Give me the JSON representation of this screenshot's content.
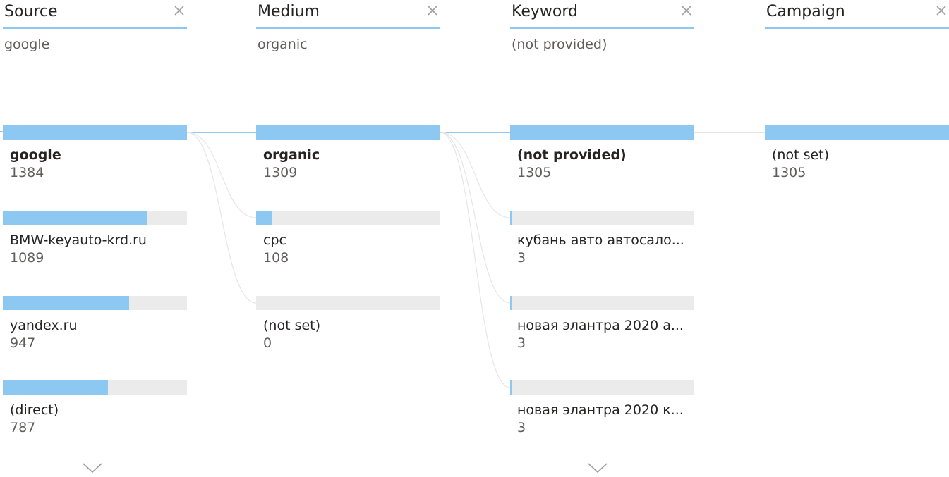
{
  "colors": {
    "accent": "#8dc8f3",
    "track": "#ebebeb",
    "text": "#252423",
    "muted": "#605e5c",
    "line": "#e0e0e0"
  },
  "columns": [
    {
      "title": "Source",
      "selected_value": "google",
      "nodes": [
        {
          "label": "google",
          "value": "1384",
          "fill_fraction": 1.0,
          "selected": true
        },
        {
          "label": "BMW-keyauto-krd.ru",
          "value": "1089",
          "fill_fraction": 0.787
        },
        {
          "label": "yandex.ru",
          "value": "947",
          "fill_fraction": 0.684
        },
        {
          "label": "(direct)",
          "value": "787",
          "fill_fraction": 0.569
        }
      ],
      "has_more": true
    },
    {
      "title": "Medium",
      "selected_value": "organic",
      "nodes": [
        {
          "label": "organic",
          "value": "1309",
          "fill_fraction": 1.0,
          "selected": true
        },
        {
          "label": "cpc",
          "value": "108",
          "fill_fraction": 0.083
        },
        {
          "label": "(not set)",
          "value": "0",
          "fill_fraction": 0.0
        }
      ],
      "has_more": false
    },
    {
      "title": "Keyword",
      "selected_value": "(not provided)",
      "nodes": [
        {
          "label": "(not provided)",
          "value": "1305",
          "fill_fraction": 1.0,
          "selected": true
        },
        {
          "label": "кубань авто автосало...",
          "value": "3",
          "fill_fraction": 0.002
        },
        {
          "label": "новая элантра 2020 а...",
          "value": "3",
          "fill_fraction": 0.002
        },
        {
          "label": "новая элантра 2020 к...",
          "value": "3",
          "fill_fraction": 0.002
        }
      ],
      "has_more": true
    },
    {
      "title": "Campaign",
      "selected_value": "",
      "nodes": [
        {
          "label": "(not set)",
          "value": "1305",
          "fill_fraction": 1.0
        }
      ],
      "has_more": false
    }
  ],
  "icons": {
    "close": "close-icon",
    "more": "chevron-down-icon"
  }
}
